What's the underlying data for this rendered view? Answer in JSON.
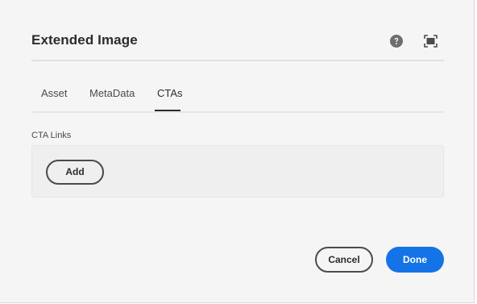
{
  "dialog": {
    "title": "Extended Image"
  },
  "header": {
    "help_icon": "help-circle-icon",
    "fullscreen_icon": "fullscreen-icon"
  },
  "tabs": [
    {
      "label": "Asset",
      "selected": false
    },
    {
      "label": "MetaData",
      "selected": false
    },
    {
      "label": "CTAs",
      "selected": true
    }
  ],
  "cta_links": {
    "label": "CTA Links",
    "add_label": "Add"
  },
  "footer": {
    "cancel_label": "Cancel",
    "done_label": "Done"
  },
  "colors": {
    "background": "#f5f5f5",
    "primary": "#1473e6",
    "text": "#2c2c2c"
  }
}
